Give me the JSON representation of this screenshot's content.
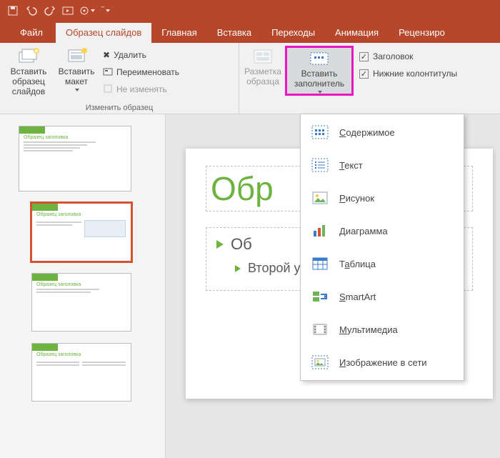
{
  "qat": [
    "save",
    "undo",
    "redo",
    "start-slideshow",
    "touch-mode"
  ],
  "tabs": {
    "file": "Файл",
    "master": "Образец слайдов",
    "home": "Главная",
    "insert": "Вставка",
    "transitions": "Переходы",
    "animations": "Анимация",
    "review": "Рецензиро"
  },
  "ribbon": {
    "insert_master": "Вставить образец слайдов",
    "insert_layout": "Вставить макет",
    "delete": "Удалить",
    "rename": "Переименовать",
    "preserve": "Не изменять",
    "group_edit": "Изменить образец",
    "master_layout": "Разметка образца",
    "insert_placeholder": "Вставить заполнитель",
    "chk_title": "Заголовок",
    "chk_footers": "Нижние колонтитулы"
  },
  "dropdown": {
    "content": "Содержимое",
    "text": "Текст",
    "picture": "Рисунок",
    "chart": "Диаграмма",
    "table": "Таблица",
    "smartart": "SmartArt",
    "media": "Мультимедиа",
    "online": "Изображение в сети"
  },
  "slide": {
    "title_partial": "Обр",
    "bullet1": "Об",
    "bullet2": "Второй уровень"
  },
  "thumb_title": "Образец заголовка"
}
